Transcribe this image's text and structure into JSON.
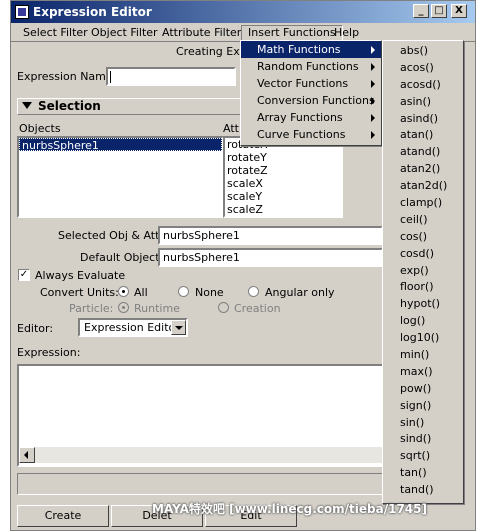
{
  "window": {
    "title": "Expression Editor",
    "min_icon": "_",
    "max_icon": "□",
    "close_icon": "X"
  },
  "menubar": {
    "items": [
      "Select Filter",
      "Object Filter",
      "Attribute Filter",
      "Insert Functions",
      "Help"
    ]
  },
  "header": {
    "creating_label": "Creating Expr"
  },
  "expression_name": {
    "label": "Expression Name",
    "value": ""
  },
  "selection": {
    "title": "Selection",
    "objects_label": "Objects",
    "attributes_label": "Attr",
    "objects": [
      "nurbsSphere1"
    ],
    "attributes": [
      "rotateX",
      "rotateY",
      "rotateZ",
      "scaleX",
      "scaleY",
      "scaleZ"
    ]
  },
  "fields": {
    "selected_label": "Selected Obj & Attr",
    "selected_value": "nurbsSphere1",
    "default_label": "Default Object",
    "default_value": "nurbsSphere1"
  },
  "options": {
    "always_evaluate": "Always Evaluate",
    "always_evaluate_checked": "✓",
    "convert_units_label": "Convert Units:",
    "convert_all": "All",
    "convert_none": "None",
    "convert_angular": "Angular only",
    "particle_label": "Particle:",
    "particle_runtime": "Runtime",
    "particle_creation": "Creation"
  },
  "editor": {
    "label": "Editor:",
    "value": "Expression Editor"
  },
  "expression": {
    "label": "Expression:"
  },
  "buttons": {
    "create": "Create",
    "delete": "Delet",
    "edit": "Edit"
  },
  "insert_menu": {
    "items": [
      "Math Functions",
      "Random Functions",
      "Vector Functions",
      "Conversion Functions",
      "Array Functions",
      "Curve Functions"
    ],
    "highlighted": "Math Functions"
  },
  "math_functions": [
    "abs()",
    "acos()",
    "acosd()",
    "asin()",
    "asind()",
    "atan()",
    "atand()",
    "atan2()",
    "atan2d()",
    "clamp()",
    "ceil()",
    "cos()",
    "cosd()",
    "exp()",
    "floor()",
    "hypot()",
    "log()",
    "log10()",
    "min()",
    "max()",
    "pow()",
    "sign()",
    "sin()",
    "sind()",
    "sqrt()",
    "tan()",
    "tand()"
  ],
  "watermark": "MAYA特效吧 [www.linecg.com/tieba/1745]"
}
